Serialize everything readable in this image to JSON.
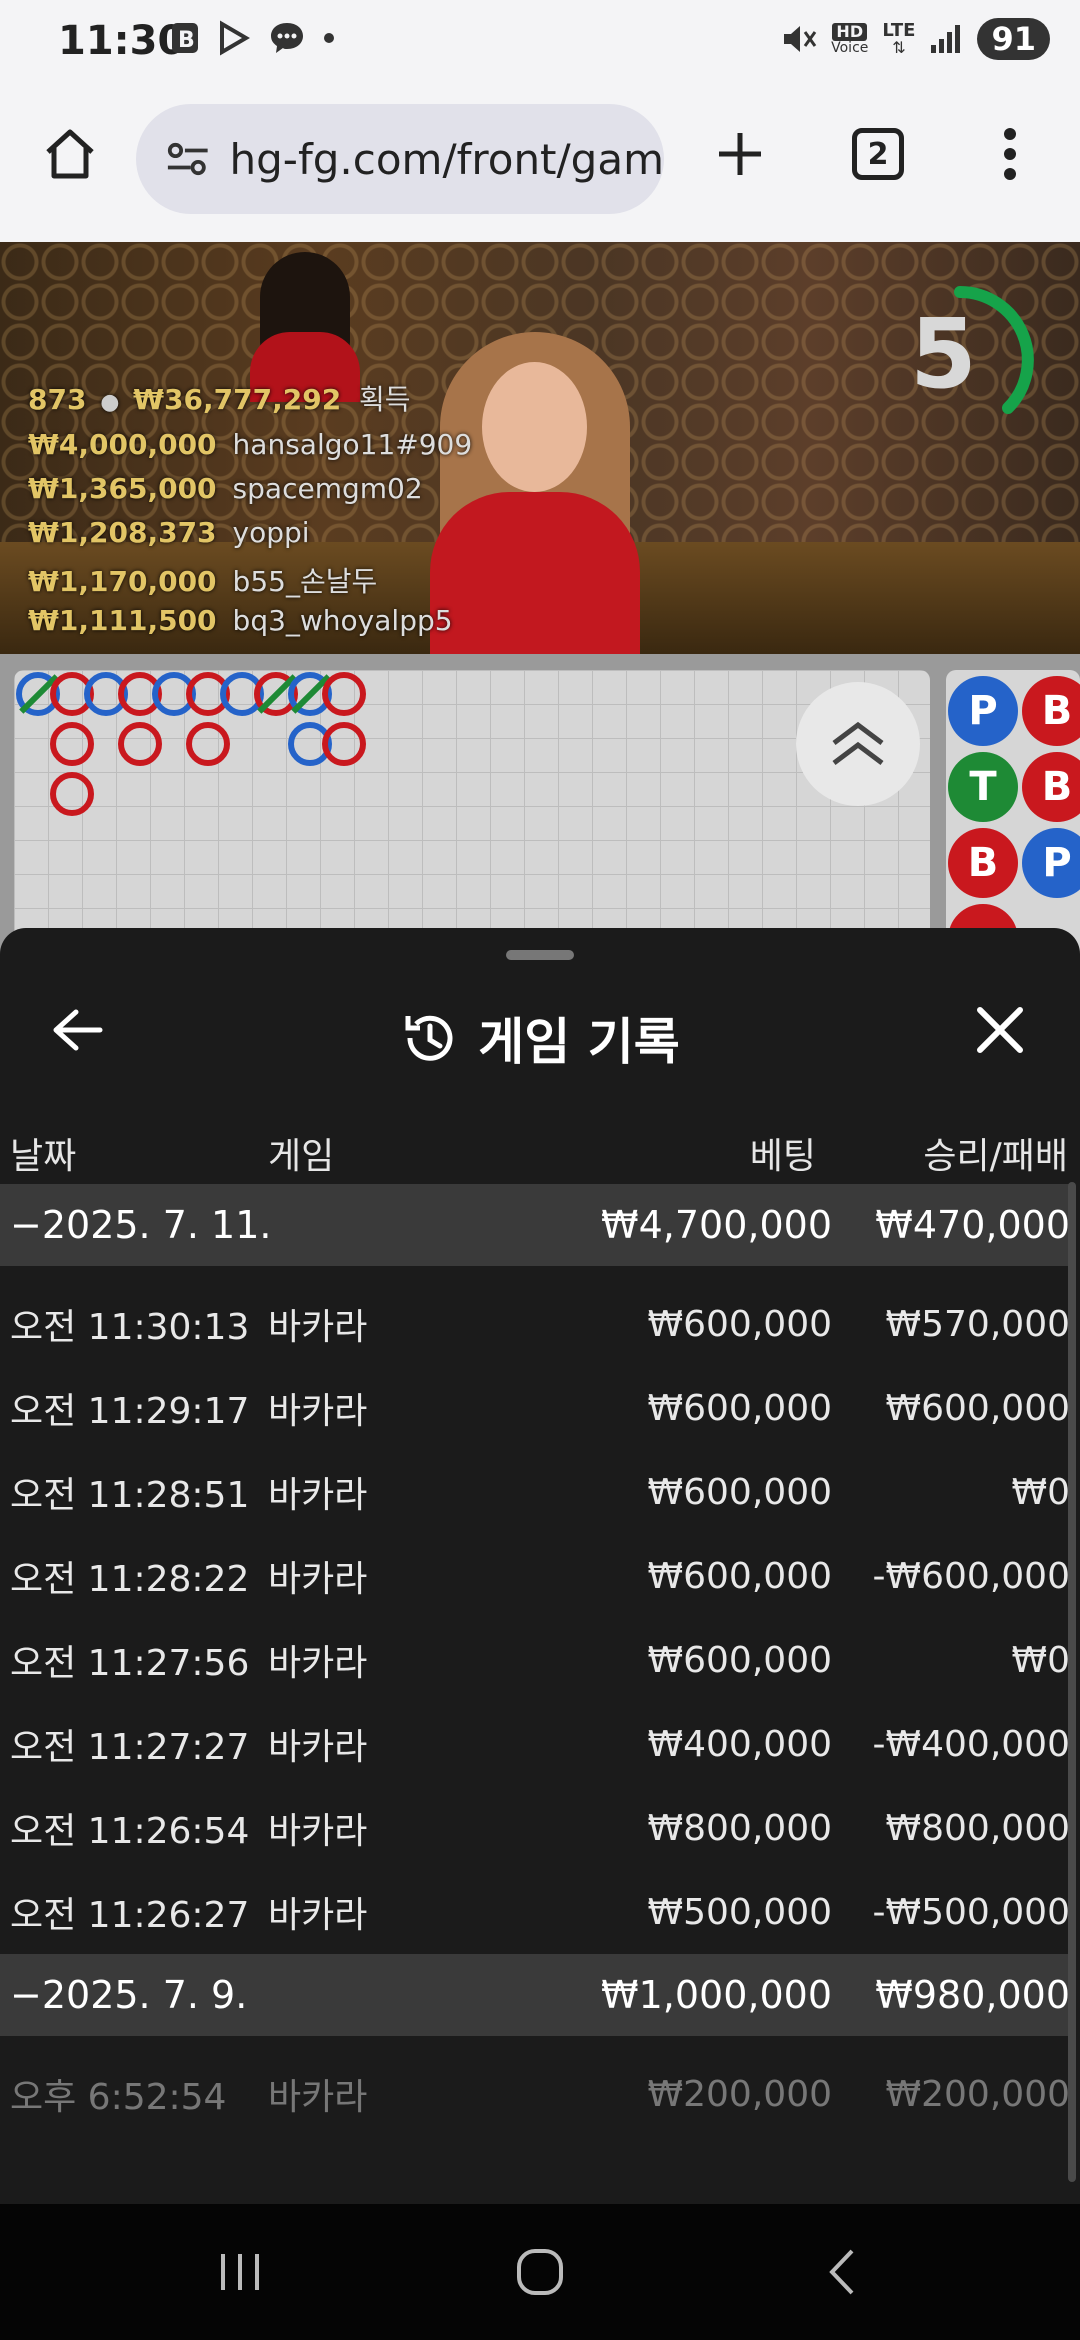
{
  "status_bar": {
    "time": "11:30",
    "battery": "91",
    "icons": [
      "b-app-icon",
      "play-icon",
      "chat-icon",
      "dot-icon",
      "mute-icon",
      "hd-voice-icon",
      "lte-icon",
      "signal-icon"
    ],
    "hd_label": "HD",
    "voice_label": "Voice",
    "lte_label": "LTE"
  },
  "browser": {
    "url": "hg-fg.com/front/gam",
    "tab_count": "2"
  },
  "video": {
    "timer": "5",
    "summary_count": "873",
    "summary_amount": "₩36,777,292",
    "summary_label": "획득",
    "winners": [
      {
        "amount": "₩4,000,000",
        "name": "hansalgo11#909"
      },
      {
        "amount": "₩1,365,000",
        "name": "spacemgm02"
      },
      {
        "amount": "₩1,208,373",
        "name": "yoppi"
      },
      {
        "amount": "₩1,170,000",
        "name": "b55_손날두"
      },
      {
        "amount": "₩1,111,500",
        "name": "bq3_whoyalpp5"
      }
    ]
  },
  "bead_pills": [
    "P",
    "B",
    "T",
    "B",
    "B",
    "P"
  ],
  "sheet": {
    "title": "게임 기록",
    "headers": {
      "date": "날짜",
      "game": "게임",
      "bet": "베팅",
      "win": "승리/패배"
    },
    "groups": [
      {
        "date": "−2025. 7. 11.",
        "bet": "₩4,700,000",
        "win": "₩470,000",
        "rows": [
          {
            "time": "오전 11:30:13",
            "game": "바카라",
            "bet": "₩600,000",
            "win": "₩570,000"
          },
          {
            "time": "오전 11:29:17",
            "game": "바카라",
            "bet": "₩600,000",
            "win": "₩600,000"
          },
          {
            "time": "오전 11:28:51",
            "game": "바카라",
            "bet": "₩600,000",
            "win": "₩0"
          },
          {
            "time": "오전 11:28:22",
            "game": "바카라",
            "bet": "₩600,000",
            "win": "-₩600,000"
          },
          {
            "time": "오전 11:27:56",
            "game": "바카라",
            "bet": "₩600,000",
            "win": "₩0"
          },
          {
            "time": "오전 11:27:27",
            "game": "바카라",
            "bet": "₩400,000",
            "win": "-₩400,000"
          },
          {
            "time": "오전 11:26:54",
            "game": "바카라",
            "bet": "₩800,000",
            "win": "₩800,000"
          },
          {
            "time": "오전 11:26:27",
            "game": "바카라",
            "bet": "₩500,000",
            "win": "-₩500,000"
          }
        ]
      },
      {
        "date": "−2025. 7. 9.",
        "bet": "₩1,000,000",
        "win": "₩980,000",
        "rows": [
          {
            "time": "오후 6:52:54",
            "game": "바카라",
            "bet": "₩200,000",
            "win": "₩200,000"
          }
        ]
      }
    ]
  },
  "colors": {
    "player_blue": "#2563c9",
    "banker_red": "#c9181e",
    "tie_green": "#1e8a35",
    "timer_green": "#16a34a",
    "overlay_gold": "#e2c566"
  }
}
